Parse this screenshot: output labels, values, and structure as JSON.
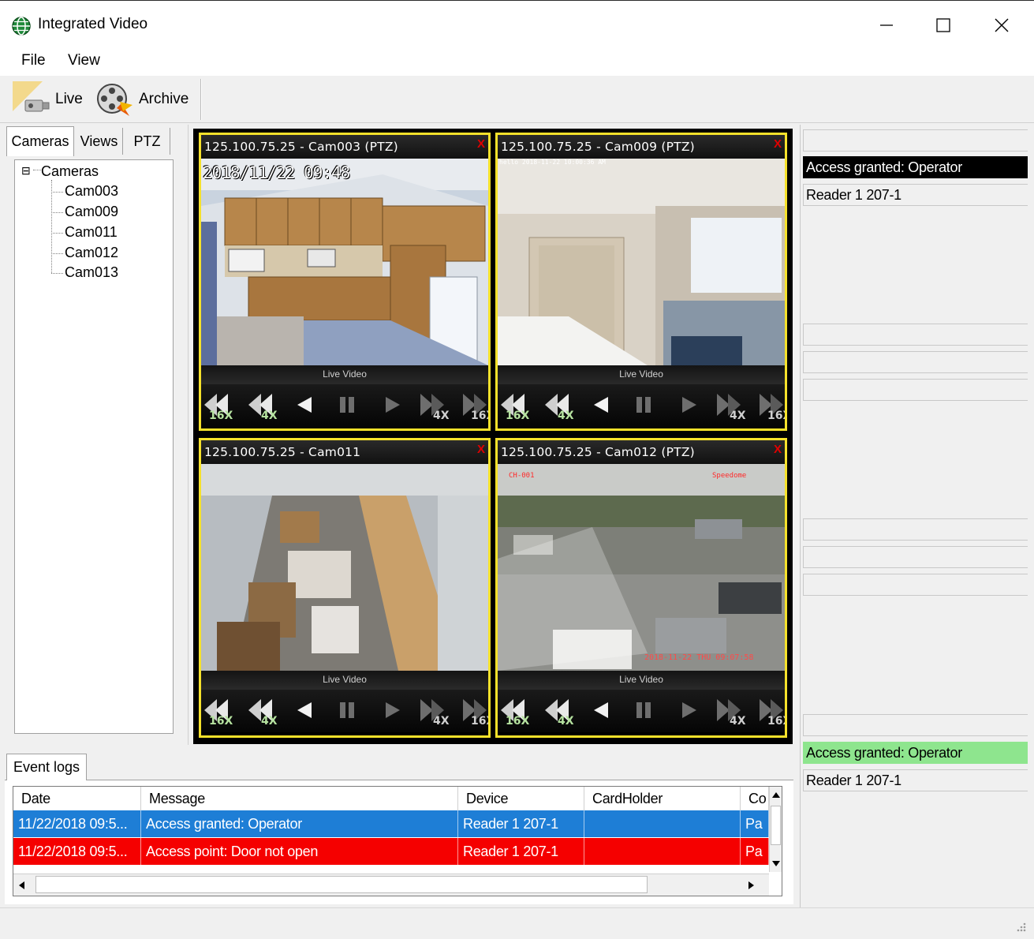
{
  "window": {
    "title": "Integrated Video",
    "min_glyph": "—",
    "max_glyph": "☐",
    "close_glyph": "✕"
  },
  "menu": {
    "file": "File",
    "view": "View"
  },
  "toolbar": {
    "live_label": "Live",
    "archive_label": "Archive"
  },
  "left_tabs": {
    "cameras": "Cameras",
    "views": "Views",
    "ptz": "PTZ"
  },
  "tree": {
    "root": "Cameras",
    "collapse_glyph": "⊟",
    "items": [
      "Cam003",
      "Cam009",
      "Cam011",
      "Cam012",
      "Cam013"
    ]
  },
  "tiles": [
    {
      "title": "125.100.75.25 - Cam003 (PTZ)",
      "close": "X",
      "status": "Live Video",
      "overlay": "2018/11/22 09:48"
    },
    {
      "title": "125.100.75.25 - Cam009 (PTZ)",
      "close": "X",
      "status": "Live Video",
      "overlay": "hello  2018-11-22 10:00:36 AM"
    },
    {
      "title": "125.100.75.25 - Cam011",
      "close": "X",
      "status": "Live Video"
    },
    {
      "title": "125.100.75.25 - Cam012 (PTZ)",
      "close": "X",
      "status": "Live Video",
      "overlay": "CH-001",
      "overlay2": "Speedome",
      "overlay3": "2018-11-22 THU 09:07:58"
    }
  ],
  "controls": {
    "speed_16x": "16X",
    "speed_4x": "4X",
    "fwd_4x": "4X",
    "fwd_16x": "16X"
  },
  "right_panel": {
    "event1_label": "Access granted: Operator",
    "event1_device": "Reader 1 207-1",
    "event2_label": "Access granted: Operator",
    "event2_device": "Reader 1 207-1"
  },
  "event_logs": {
    "tab": "Event logs",
    "columns": [
      "Date",
      "Message",
      "Device",
      "CardHolder",
      "Co"
    ],
    "rows": [
      {
        "date": "11/22/2018 09:5...",
        "message": "Access granted: Operator",
        "device": "Reader 1 207-1",
        "cardholder": "",
        "extra": "Pa"
      },
      {
        "date": "11/22/2018 09:5...",
        "message": "Access point: Door not open",
        "device": "Reader 1 207-1",
        "cardholder": "",
        "extra": "Pa"
      }
    ],
    "row_colors": [
      "#1e7ed6",
      "#f50000"
    ]
  }
}
